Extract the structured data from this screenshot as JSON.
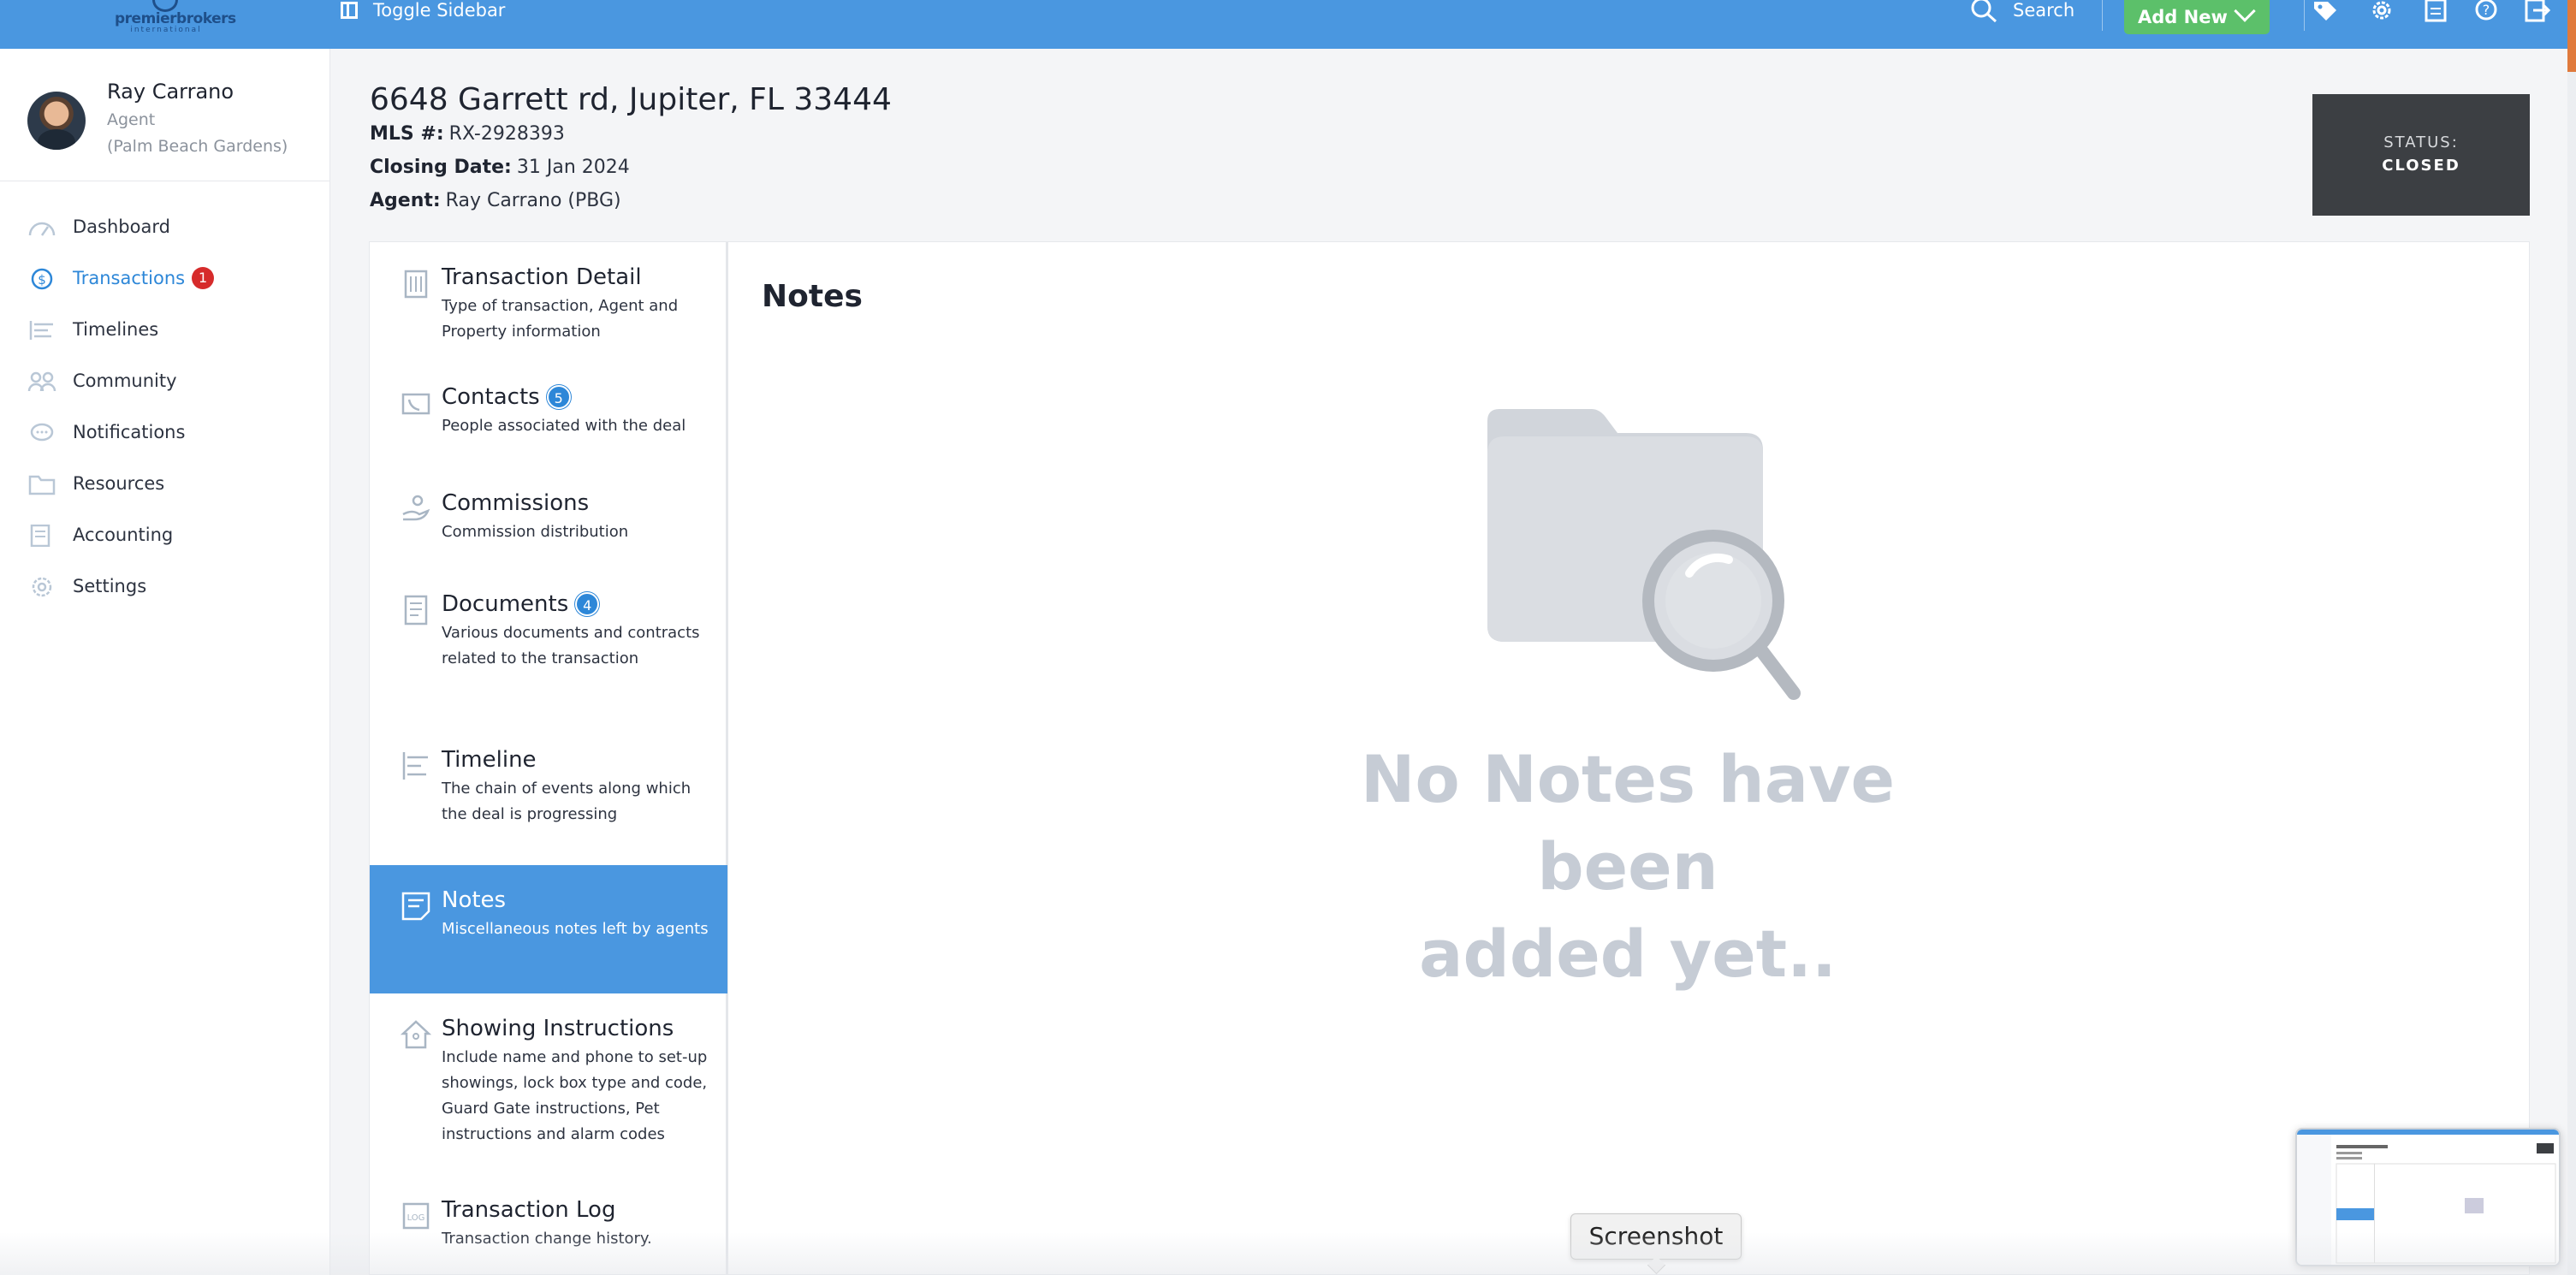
{
  "topbar": {
    "logo_name": "premierbrokers",
    "logo_sub": "international",
    "toggle_label": "Toggle Sidebar",
    "search_label": "Search",
    "add_new_label": "Add New",
    "icons": [
      "tag-icon",
      "gear-icon",
      "calculator-icon",
      "help-icon",
      "logout-icon"
    ]
  },
  "profile": {
    "name": "Ray Carrano",
    "role": "Agent",
    "office": "(Palm Beach Gardens)"
  },
  "sidebar": {
    "items": [
      {
        "label": "Dashboard",
        "icon": "dashboard-icon"
      },
      {
        "label": "Transactions",
        "icon": "transactions-icon",
        "badge": "1",
        "active": true
      },
      {
        "label": "Timelines",
        "icon": "timelines-icon"
      },
      {
        "label": "Community",
        "icon": "community-icon"
      },
      {
        "label": "Notifications",
        "icon": "notifications-icon"
      },
      {
        "label": "Resources",
        "icon": "resources-icon"
      },
      {
        "label": "Accounting",
        "icon": "accounting-icon"
      },
      {
        "label": "Settings",
        "icon": "settings-icon"
      }
    ]
  },
  "header": {
    "title": "6648 Garrett rd, Jupiter, FL 33444",
    "mls_label": "MLS #:",
    "mls_value": "RX-2928393",
    "closing_label": "Closing Date:",
    "closing_value": "31 Jan 2024",
    "agent_label": "Agent:",
    "agent_value": "Ray Carrano (PBG)"
  },
  "status": {
    "label": "STATUS:",
    "value": "CLOSED"
  },
  "tabs": [
    {
      "title": "Transaction Detail",
      "desc": "Type of transaction, Agent and Property information"
    },
    {
      "title": "Contacts",
      "badge": "5",
      "desc": "People associated with the deal"
    },
    {
      "title": "Commissions",
      "desc": "Commission distribution"
    },
    {
      "title": "Documents",
      "badge": "4",
      "desc": "Various documents and contracts related to the transaction"
    },
    {
      "title": "Timeline",
      "desc": "The chain of events along which the deal is progressing"
    },
    {
      "title": "Notes",
      "desc": "Miscellaneous notes left by agents",
      "active": true
    },
    {
      "title": "Showing Instructions",
      "desc": "Include name and phone to set-up showings, lock box type and code, Guard Gate instructions, Pet instructions and alarm codes"
    },
    {
      "title": "Transaction Log",
      "desc": "Transaction change history."
    }
  ],
  "content": {
    "title": "Notes",
    "empty_line1": "No Notes have been",
    "empty_line2": "added yet.."
  },
  "overlay": {
    "tooltip": "Screenshot"
  },
  "colors": {
    "accent": "#4a97e0",
    "add_new": "#5cc06a",
    "status_bg": "#3c3f43",
    "badge_red": "#d62b2b",
    "badge_blue": "#2d87d8"
  }
}
